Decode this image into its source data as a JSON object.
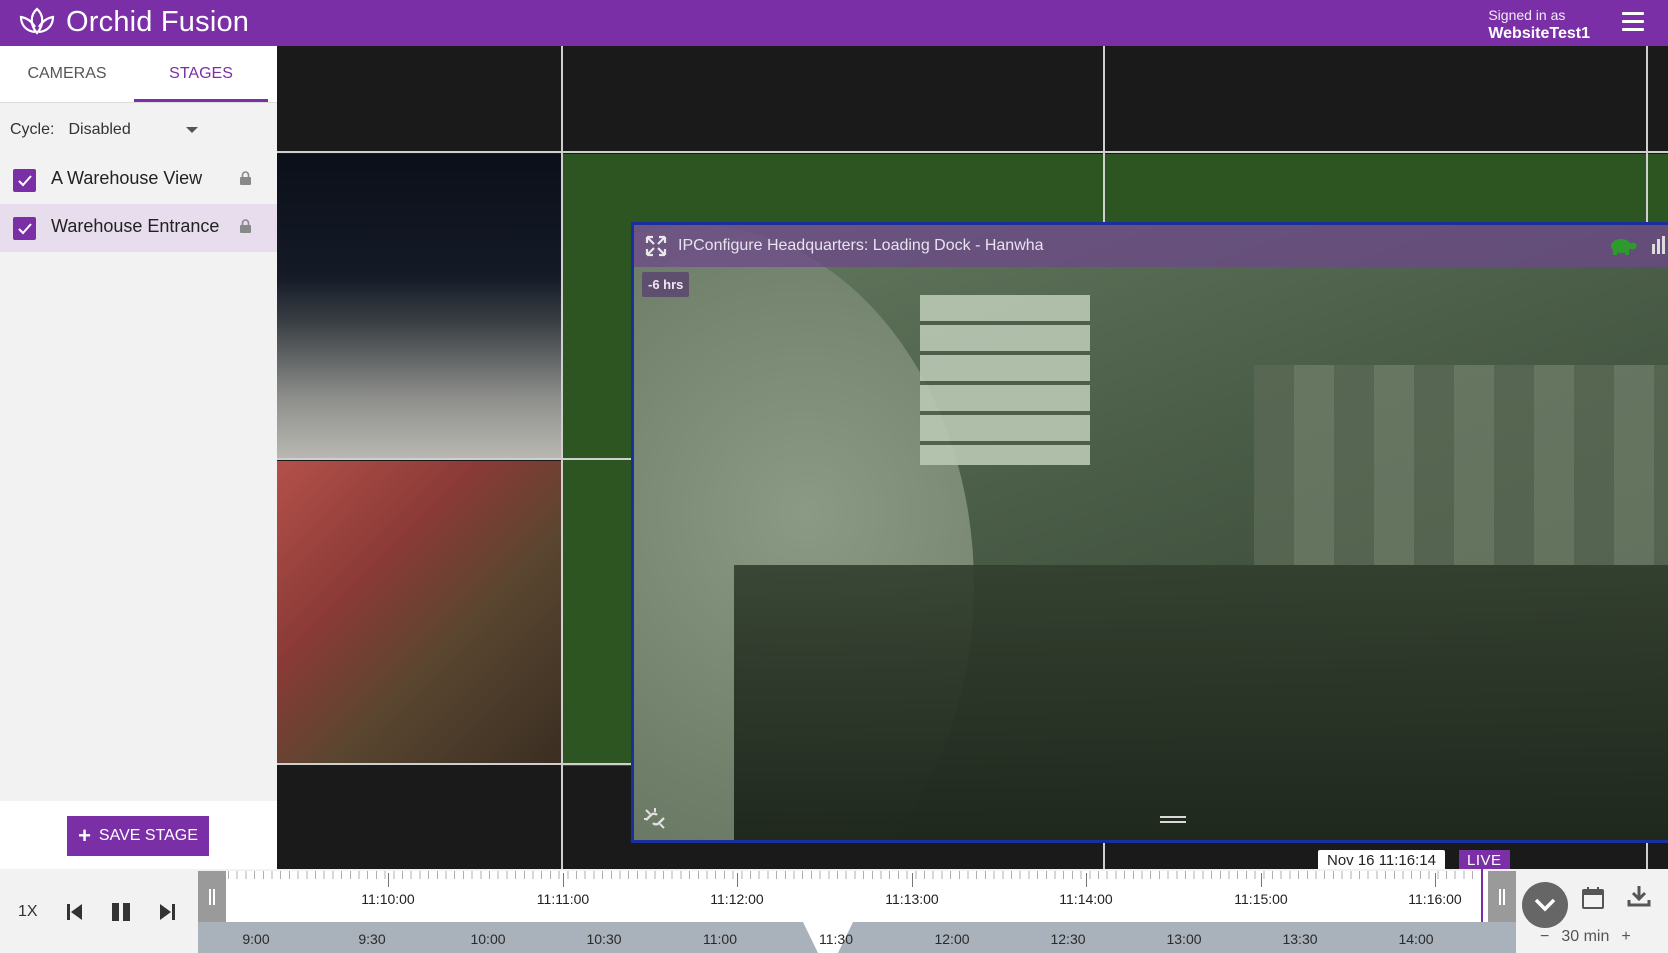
{
  "app": {
    "brand": "Orchid Fusion",
    "signed_in_label": "Signed in as",
    "username": "WebsiteTest1"
  },
  "sidebar": {
    "tabs": [
      {
        "label": "CAMERAS",
        "active": false
      },
      {
        "label": "STAGES",
        "active": true
      }
    ],
    "cycle_label": "Cycle:",
    "cycle_value": "Disabled",
    "stages": [
      {
        "label": "A Warehouse View",
        "checked": true,
        "locked": true,
        "selected": false
      },
      {
        "label": "Warehouse Entrance",
        "checked": true,
        "locked": true,
        "selected": true
      }
    ],
    "save_label": "SAVE STAGE"
  },
  "camera_tile": {
    "title": "IPConfigure Headquarters: Loading Dock - Hanwha",
    "offset_badge": "-6 hrs"
  },
  "playback": {
    "timestamp": "Nov 16 11:16:14",
    "live_label": "LIVE",
    "speed": "1X",
    "timeline_top_labels": [
      "11:10:00",
      "11:11:00",
      "11:12:00",
      "11:13:00",
      "11:14:00",
      "11:15:00",
      "11:16:00"
    ],
    "timeline_bottom_labels": [
      "9:00",
      "9:30",
      "10:00",
      "10:30",
      "11:00",
      "11:30",
      "12:00",
      "12:30",
      "13:00",
      "13:30",
      "14:00"
    ],
    "zoom_minus": "−",
    "zoom_value": "30 min",
    "zoom_plus": "+"
  },
  "colors": {
    "brand": "#7b2fa6",
    "tile_border": "#1a2f9e",
    "stage_green": "#2d5522"
  },
  "icons": [
    "lotus-logo-icon",
    "hamburger-menu-icon",
    "checkbox-checked-icon",
    "lock-icon",
    "plus-icon",
    "expand-icon",
    "turtle-icon",
    "stats-icon",
    "unlink-icon",
    "drag-handle-icon",
    "skip-back-icon",
    "pause-icon",
    "skip-forward-icon",
    "chevron-down-icon",
    "calendar-icon",
    "download-icon"
  ]
}
